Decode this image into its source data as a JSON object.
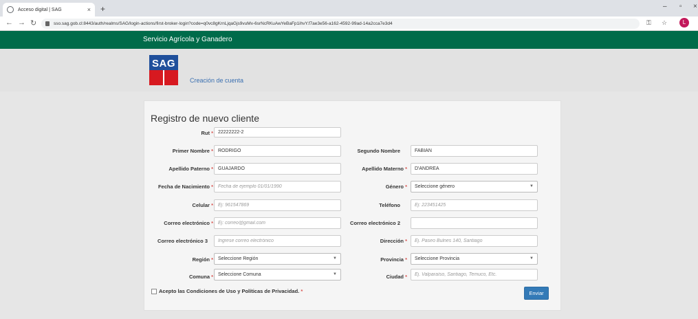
{
  "browser": {
    "tab_title": "Acceso digital | SAG",
    "url": "sso.sag.gob.cl:8443/auth/realms/SAG/login-actions/first-broker-login?code=q0vc8gKrnLjqaGjs9vuMv-6srNcRKuAwYeBaFp1ihvY.f7ae3e56-a162-4592-99ad-14a2cca7e3d4",
    "profile_initial": "L"
  },
  "site": {
    "brand": "Servicio Agrícola y Ganadero",
    "logo_text": "SAG",
    "page_subtitle": "Creación de cuenta",
    "colors": {
      "header": "#006b4a",
      "logo_blue": "#1f4f9b",
      "logo_red": "#d71920",
      "button": "#337ab7"
    }
  },
  "form": {
    "title": "Registro de nuevo cliente",
    "required_mark": "*",
    "rut": {
      "label": "Rut",
      "value": "22222222-2"
    },
    "primer_nombre": {
      "label": "Primer Nombre",
      "value": "RODRIGO"
    },
    "segundo_nombre": {
      "label": "Segundo Nombre",
      "value": "FABIÁN"
    },
    "apellido_paterno": {
      "label": "Apellido Paterno",
      "value": "GUAJARDO"
    },
    "apellido_materno": {
      "label": "Apellido Materno",
      "value": "D'ANDREA"
    },
    "fecha_nacimiento": {
      "label": "Fecha de Nacimiento",
      "placeholder": "Fecha de ejemplo 01/01/1990"
    },
    "genero": {
      "label": "Género",
      "selected": "Seleccione género"
    },
    "celular": {
      "label": "Celular",
      "placeholder": "Ej: 961547869"
    },
    "telefono": {
      "label": "Teléfono",
      "placeholder": "Ej: 223451425"
    },
    "correo1": {
      "label": "Correo electrónico",
      "placeholder": "Ej: correo@gmail.com"
    },
    "correo2": {
      "label": "Correo electrónico 2",
      "placeholder": ""
    },
    "correo3": {
      "label": "Correo electrónico 3",
      "placeholder": "Ingrese correo electrónico"
    },
    "direccion": {
      "label": "Dirección",
      "placeholder": "Ej. Paseo Bulnes 140, Santiago"
    },
    "region": {
      "label": "Región",
      "selected": "Seleccione Región"
    },
    "provincia": {
      "label": "Provincia",
      "selected": "Seleccione Provincia"
    },
    "comuna": {
      "label": "Comuna",
      "selected": "Seleccione Comuna"
    },
    "ciudad": {
      "label": "Ciudad",
      "placeholder": "Ej. Valparaíso, Santiago, Temuco, Etc."
    },
    "terms": "Acepto las Condiciones de Uso y Políticas de Privacidad.",
    "submit": "Enviar"
  }
}
